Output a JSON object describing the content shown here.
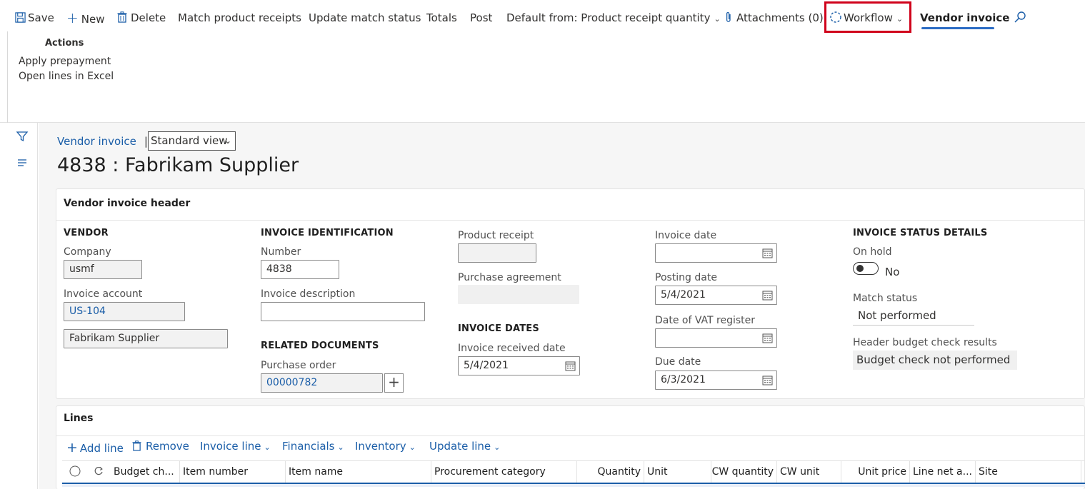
{
  "toolbar": {
    "save": "Save",
    "new": "New",
    "delete": "Delete",
    "match_receipts": "Match product receipts",
    "update_match": "Update match status",
    "totals": "Totals",
    "post": "Post",
    "default_from": "Default from: Product receipt quantity",
    "attachments": "Attachments (0)",
    "workflow": "Workflow",
    "vendor_invoice_tab": "Vendor invoice",
    "highlight_color": "#d0021b",
    "accent_color": "#2b6cc4"
  },
  "actions_group": {
    "title": "Actions",
    "items": [
      "Apply prepayment",
      "Open lines in Excel"
    ]
  },
  "breadcrumb": {
    "link": "Vendor invoice",
    "separator": "|",
    "view": "Standard view"
  },
  "page_title": "4838 : Fabrikam Supplier",
  "header_card": {
    "title": "Vendor invoice header",
    "vendor": {
      "section": "VENDOR",
      "company_label": "Company",
      "company_value": "usmf",
      "invoice_account_label": "Invoice account",
      "invoice_account_value": "US-104",
      "name_value": "Fabrikam Supplier"
    },
    "invoice_identification": {
      "section": "INVOICE IDENTIFICATION",
      "number_label": "Number",
      "number_value": "4838",
      "description_label": "Invoice description",
      "description_value": ""
    },
    "related_documents": {
      "section": "RELATED DOCUMENTS",
      "po_label": "Purchase order",
      "po_value": "00000782"
    },
    "product_receipt_label": "Product receipt",
    "purchase_agreement_label": "Purchase agreement",
    "invoice_dates": {
      "section": "INVOICE DATES",
      "received_label": "Invoice received date",
      "received_value": "5/4/2021"
    },
    "dates": {
      "invoice_date_label": "Invoice date",
      "invoice_date_value": "",
      "posting_date_label": "Posting date",
      "posting_date_value": "5/4/2021",
      "vat_date_label": "Date of VAT register",
      "vat_date_value": "",
      "due_date_label": "Due date",
      "due_date_value": "6/3/2021"
    },
    "status": {
      "section": "INVOICE STATUS DETAILS",
      "on_hold_label": "On hold",
      "on_hold_value": "No",
      "match_status_label": "Match status",
      "match_status_value": "Not performed",
      "budget_label": "Header budget check results",
      "budget_value": "Budget check not performed"
    }
  },
  "lines": {
    "title": "Lines",
    "toolbar": {
      "add_line": "Add line",
      "remove": "Remove",
      "invoice_line": "Invoice line",
      "financials": "Financials",
      "inventory": "Inventory",
      "update_line": "Update line"
    },
    "columns": {
      "budget": "Budget ch...",
      "item_number": "Item number",
      "item_name": "Item name",
      "procurement": "Procurement category",
      "quantity": "Quantity",
      "unit": "Unit",
      "cw_quantity": "CW quantity",
      "cw_unit": "CW unit",
      "unit_price": "Unit price",
      "line_net": "Line net a...",
      "site": "Site"
    }
  }
}
